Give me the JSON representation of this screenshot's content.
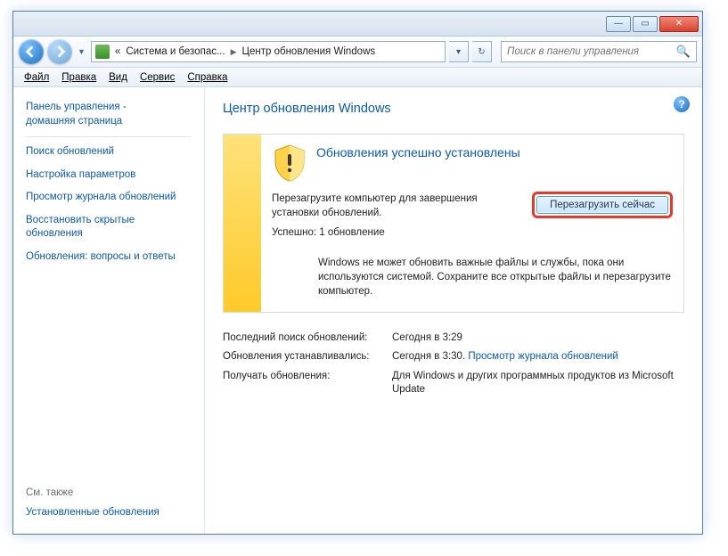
{
  "breadcrumb": {
    "level1": "Система и безопас...",
    "level2": "Центр обновления Windows",
    "prefix": "«"
  },
  "search": {
    "placeholder": "Поиск в панели управления"
  },
  "menu": {
    "file": "Файл",
    "edit": "Правка",
    "view": "Вид",
    "tools": "Сервис",
    "help": "Справка"
  },
  "sidebar": {
    "home1": "Панель управления -",
    "home2": "домашняя страница",
    "items": [
      "Поиск обновлений",
      "Настройка параметров",
      "Просмотр журнала обновлений",
      "Восстановить скрытые обновления",
      "Обновления: вопросы и ответы"
    ],
    "see_also": "См. также",
    "installed": "Установленные обновления"
  },
  "page": {
    "title": "Центр обновления Windows"
  },
  "status": {
    "title": "Обновления успешно установлены",
    "msg1": "Перезагрузите компьютер для завершения установки обновлений.",
    "msg2": "Успешно: 1 обновление",
    "button": "Перезагрузить сейчас",
    "note": "Windows не может обновить важные файлы и службы, пока они используются системой. Сохраните все открытые файлы и перезагрузите компьютер."
  },
  "info": {
    "row1": {
      "label": "Последний поиск обновлений:",
      "val": "Сегодня в 3:29"
    },
    "row2": {
      "label": "Обновления устанавливались:",
      "val": "Сегодня в 3:30.",
      "link": "Просмотр журнала обновлений"
    },
    "row3": {
      "label": "Получать обновления:",
      "val": "Для Windows и других программных продуктов из Microsoft Update"
    }
  }
}
